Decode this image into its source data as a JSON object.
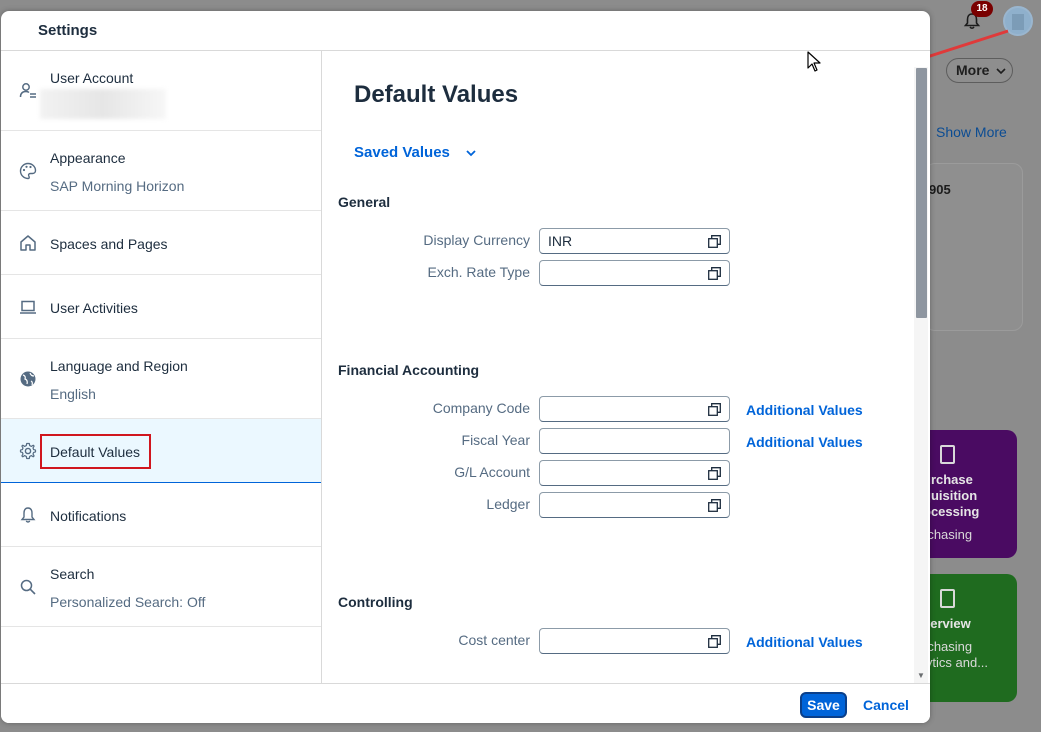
{
  "background": {
    "notification_count": "18",
    "more_label": "More",
    "show_more": "Show More",
    "card_fragment": "905",
    "tile_purple": {
      "title_lines": [
        "urchase",
        "quisition",
        "ocessing"
      ],
      "subtitle": "rchasing"
    },
    "tile_green": {
      "title": "verview",
      "subtitle_lines": [
        "rchasing",
        "lytics and..."
      ]
    }
  },
  "dialog": {
    "title": "Settings",
    "nav": [
      {
        "label": "User Account",
        "sublabel": ""
      },
      {
        "label": "Appearance",
        "sublabel": "SAP Morning Horizon"
      },
      {
        "label": "Spaces and Pages",
        "sublabel": ""
      },
      {
        "label": "User Activities",
        "sublabel": ""
      },
      {
        "label": "Language and Region",
        "sublabel": "English"
      },
      {
        "label": "Default Values",
        "sublabel": ""
      },
      {
        "label": "Notifications",
        "sublabel": ""
      },
      {
        "label": "Search",
        "sublabel": "Personalized Search: Off"
      }
    ],
    "content": {
      "title": "Default Values",
      "saved_values": "Saved Values",
      "sections": {
        "general": "General",
        "financial": "Financial Accounting",
        "controlling": "Controlling"
      },
      "fields": {
        "display_currency": {
          "label": "Display Currency",
          "value": "INR"
        },
        "exch_rate_type": {
          "label": "Exch. Rate Type",
          "value": ""
        },
        "company_code": {
          "label": "Company Code",
          "value": ""
        },
        "fiscal_year": {
          "label": "Fiscal Year",
          "value": ""
        },
        "gl_account": {
          "label": "G/L Account",
          "value": ""
        },
        "ledger": {
          "label": "Ledger",
          "value": ""
        },
        "cost_center": {
          "label": "Cost center",
          "value": ""
        }
      },
      "additional_values": "Additional Values"
    },
    "footer": {
      "save": "Save",
      "cancel": "Cancel"
    }
  }
}
